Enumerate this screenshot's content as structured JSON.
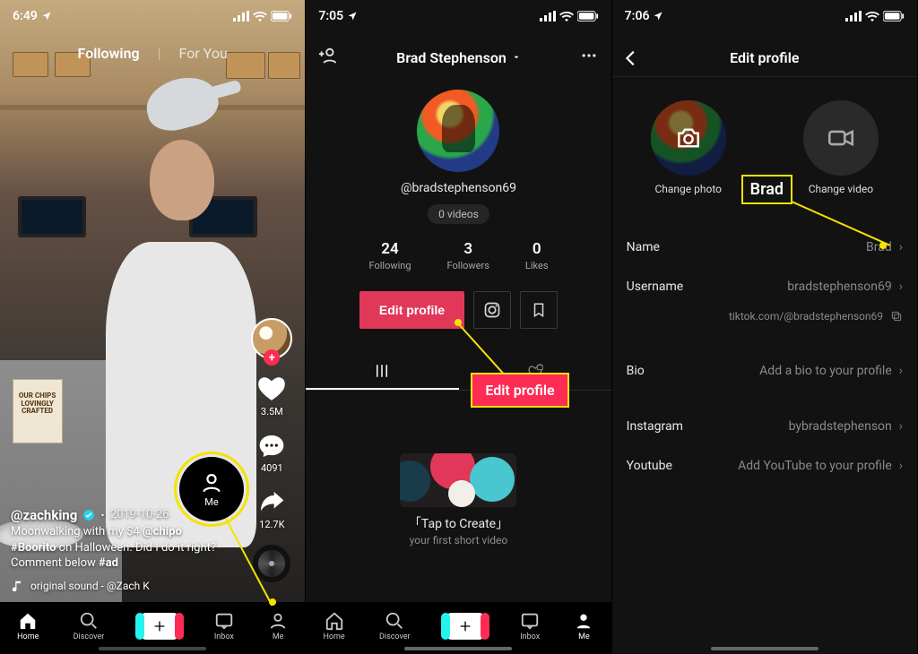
{
  "accent": "#fe2c55",
  "highlight": "#f4e300",
  "screen1": {
    "time": "6:49",
    "tabs": {
      "following": "Following",
      "foryou": "For You"
    },
    "rail": {
      "likes": "3.5M",
      "comments": "4091",
      "shares": "12.7K"
    },
    "caption": {
      "user": "@zachking",
      "date": "2019-10-26",
      "line1_pre": "Moonwalking with my $4 ",
      "line1_mention": "@chipo",
      "line1_post": "",
      "line2_pre": "",
      "line2_hash": "#Boorito",
      "line2_post": " on Halloween. Did I do it right?",
      "line3_pre": "Comment below ",
      "line3_hash": "#ad",
      "sound": "original sound - @Zach K"
    },
    "chipbag": "OUR\nCHIPS\nLOVINGLY\nCRAFTED",
    "me_float": "Me",
    "nav": {
      "home": "Home",
      "discover": "Discover",
      "inbox": "Inbox",
      "me": "Me"
    }
  },
  "screen2": {
    "time": "7:05",
    "name": "Brad Stephenson",
    "handle": "@bradstephenson69",
    "video_pill": "0 videos",
    "stats": {
      "following_n": "24",
      "following_l": "Following",
      "followers_n": "3",
      "followers_l": "Followers",
      "likes_n": "0",
      "likes_l": "Likes"
    },
    "edit_btn": "Edit profile",
    "tap_create_title": "「Tap to Create」",
    "tap_create_sub": "your first short video",
    "nav": {
      "home": "Home",
      "discover": "Discover",
      "inbox": "Inbox",
      "me": "Me"
    },
    "anno_label": "Edit profile"
  },
  "screen3": {
    "time": "7:06",
    "title": "Edit profile",
    "change_photo": "Change photo",
    "change_video": "Change video",
    "rows": {
      "name_l": "Name",
      "name_v": "Brad",
      "username_l": "Username",
      "username_v": "bradstephenson69",
      "link": "tiktok.com/@bradstephenson69",
      "bio_l": "Bio",
      "bio_v": "Add a bio to your profile",
      "instagram_l": "Instagram",
      "instagram_v": "bybradstephenson",
      "youtube_l": "Youtube",
      "youtube_v": "Add YouTube to your profile"
    },
    "anno_label": "Brad"
  }
}
